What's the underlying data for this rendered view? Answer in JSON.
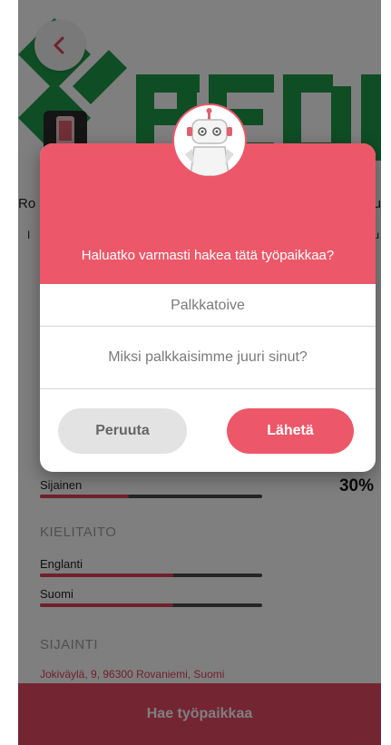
{
  "background": {
    "brand_text": "REDU",
    "peek_left": "Ro",
    "peek_right": "elu",
    "peek_left2": "I",
    "peek_right2": "u",
    "match_percent": "30%",
    "skills": [
      {
        "label": "Sijainen",
        "level": 0.4
      }
    ],
    "languages_heading": "KIELITAITO",
    "languages": [
      {
        "label": "Englanti",
        "level": 0.6
      },
      {
        "label": "Suomi",
        "level": 0.6
      }
    ],
    "location_heading": "SIJAINTI",
    "address": "Jokiväylä, 9, 96300 Rovaniemi, Suomi",
    "apply_label": "Hae työpaikkaa",
    "icons": {
      "back": "chevron-left-icon",
      "favorite": "heart-icon",
      "share": "share-icon"
    }
  },
  "modal": {
    "question": "Haluatko varmasti hakea tätä työpaikkaa?",
    "salary_placeholder": "Palkkatoive",
    "salary_value": "",
    "reason_placeholder": "Miksi palkkaisimme juuri sinut?",
    "reason_value": "",
    "cancel_label": "Peruuta",
    "send_label": "Lähetä"
  },
  "colors": {
    "accent": "#ec5869",
    "brand_green": "#1f9a4a",
    "overlay": "rgba(0,0,0,0.5)"
  }
}
